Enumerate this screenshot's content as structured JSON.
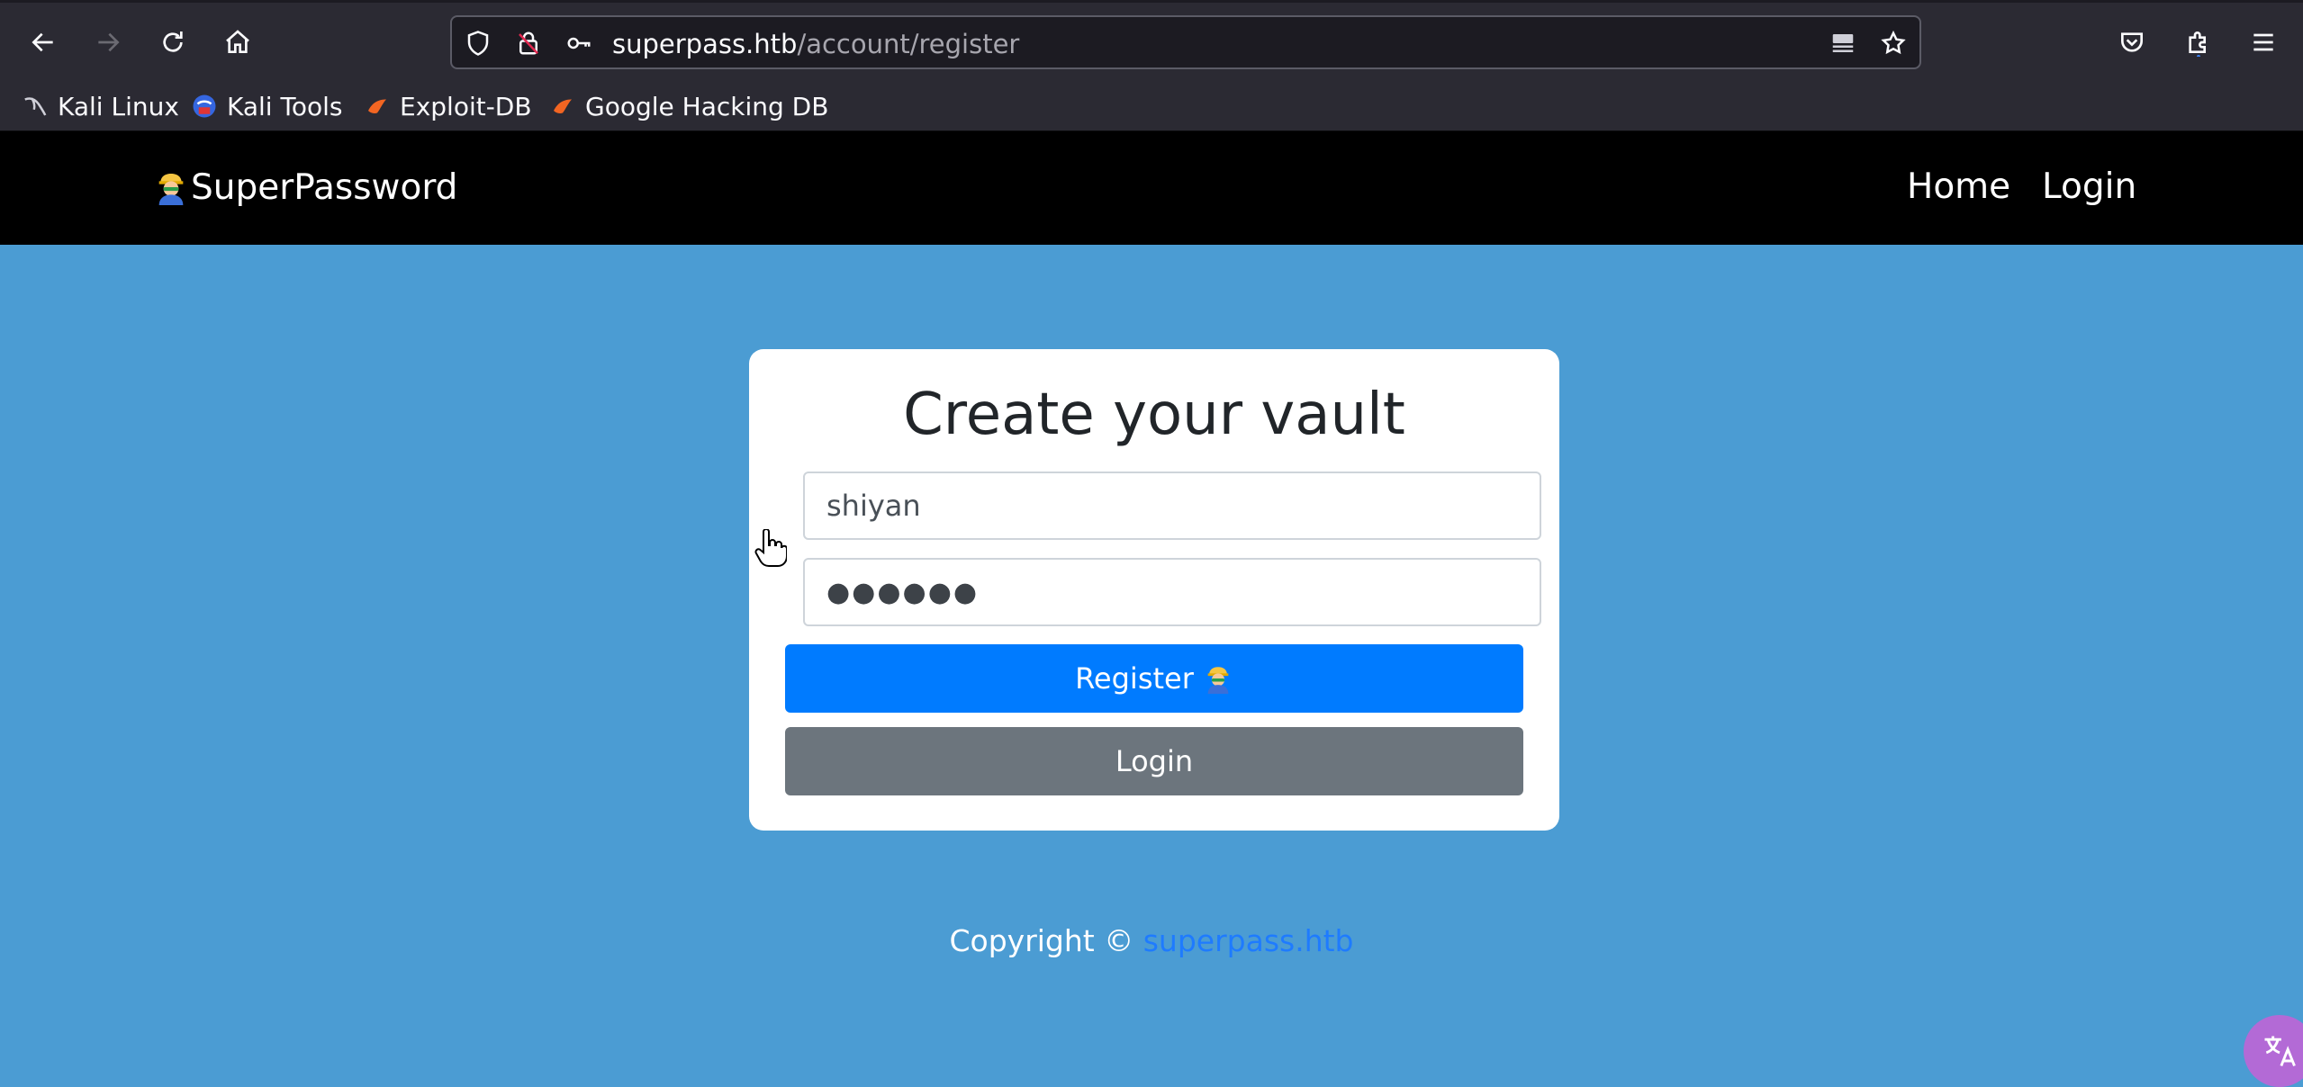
{
  "browser": {
    "url_host": "superpass.htb",
    "url_path": "/account/register",
    "bookmarks": [
      {
        "label": "Kali Linux",
        "icon": "kali-dragon-icon"
      },
      {
        "label": "Kali Tools",
        "icon": "kali-tools-icon"
      },
      {
        "label": "Exploit-DB",
        "icon": "exploit-db-icon"
      },
      {
        "label": "Google Hacking DB",
        "icon": "ghdb-icon"
      }
    ]
  },
  "site": {
    "brand": "SuperPassword",
    "nav": {
      "home": "Home",
      "login": "Login"
    }
  },
  "form": {
    "title": "Create your vault",
    "username_value": "shiyan",
    "password_value": "●●●●●●",
    "register_label": "Register",
    "login_label": "Login"
  },
  "footer": {
    "text": "Copyright ©",
    "link": "superpass.htb"
  },
  "colors": {
    "page_bg": "#4b9cd3",
    "navbar_bg": "#000000",
    "primary": "#007bff",
    "secondary": "#6c757d"
  }
}
